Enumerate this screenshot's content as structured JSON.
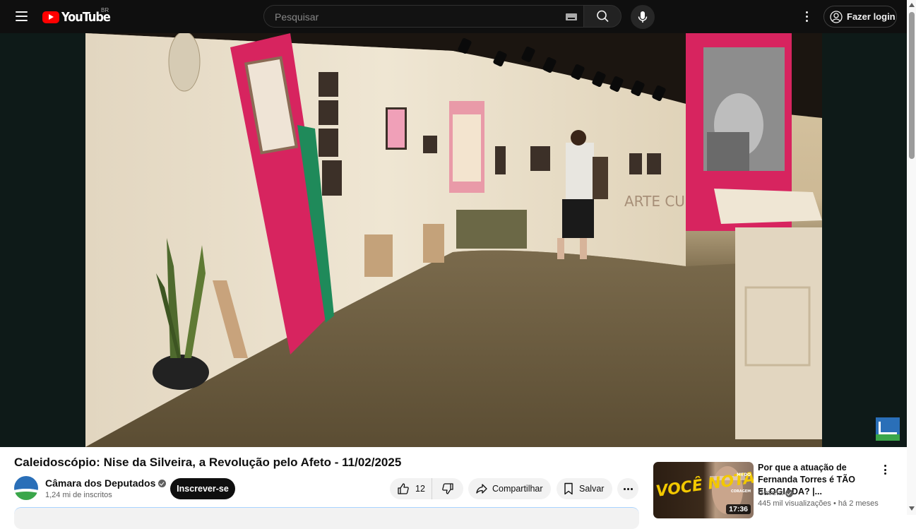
{
  "header": {
    "logo_text": "YouTube",
    "region": "BR",
    "search_placeholder": "Pesquisar",
    "login_label": "Fazer login"
  },
  "player": {
    "scene_text": "ARTE CURA"
  },
  "video": {
    "title": "Caleidoscópio: Nise da Silveira, a Revolução pelo Afeto - 11/02/2025",
    "channel_name": "Câmara dos Deputados",
    "subscribers": "1,24 mi de inscritos",
    "subscribe_label": "Inscrever-se",
    "likes": "12",
    "share_label": "Compartilhar",
    "save_label": "Salvar"
  },
  "recommendation": {
    "title": "Por que a atuação de Fernanda Torres é TÃO ELOGIADA? |...",
    "channel": "Gaveta",
    "views": "445 mil visualizações",
    "age": "há 2 meses",
    "duration": "17:36",
    "thumb_text_main": "VOCÊ NOTA?",
    "thumb_text_top": "MEDO",
    "thumb_text_mid": "CORAGEM"
  },
  "colors": {
    "header_bg": "#0f0f0f",
    "brand_red": "#ff0000",
    "exhibit_magenta": "#d7245f",
    "exhibit_green": "#1f8a5a"
  }
}
